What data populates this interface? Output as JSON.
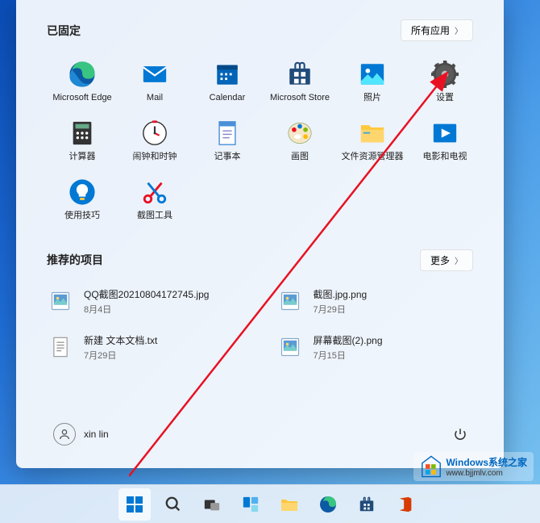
{
  "pinned": {
    "title": "已固定",
    "allAppsLabel": "所有应用",
    "apps": [
      {
        "name": "Microsoft Edge",
        "icon": "edge"
      },
      {
        "name": "Mail",
        "icon": "mail"
      },
      {
        "name": "Calendar",
        "icon": "calendar"
      },
      {
        "name": "Microsoft Store",
        "icon": "store"
      },
      {
        "name": "照片",
        "icon": "photos"
      },
      {
        "name": "设置",
        "icon": "settings"
      },
      {
        "name": "计算器",
        "icon": "calculator"
      },
      {
        "name": "闹钟和时钟",
        "icon": "clock"
      },
      {
        "name": "记事本",
        "icon": "notepad"
      },
      {
        "name": "画图",
        "icon": "paint"
      },
      {
        "name": "文件资源管理器",
        "icon": "explorer"
      },
      {
        "name": "电影和电视",
        "icon": "movies"
      },
      {
        "name": "使用技巧",
        "icon": "tips"
      },
      {
        "name": "截图工具",
        "icon": "snip"
      }
    ]
  },
  "recommended": {
    "title": "推荐的项目",
    "moreLabel": "更多",
    "items": [
      {
        "name": "QQ截图20210804172745.jpg",
        "date": "8月4日",
        "icon": "image"
      },
      {
        "name": "截图.jpg.png",
        "date": "7月29日",
        "icon": "image"
      },
      {
        "name": "新建 文本文档.txt",
        "date": "7月29日",
        "icon": "text"
      },
      {
        "name": "屏幕截图(2).png",
        "date": "7月15日",
        "icon": "image"
      }
    ]
  },
  "user": {
    "name": "xin lin"
  },
  "watermark": {
    "title": "Windows系统之家",
    "url": "www.bjjmlv.com"
  }
}
